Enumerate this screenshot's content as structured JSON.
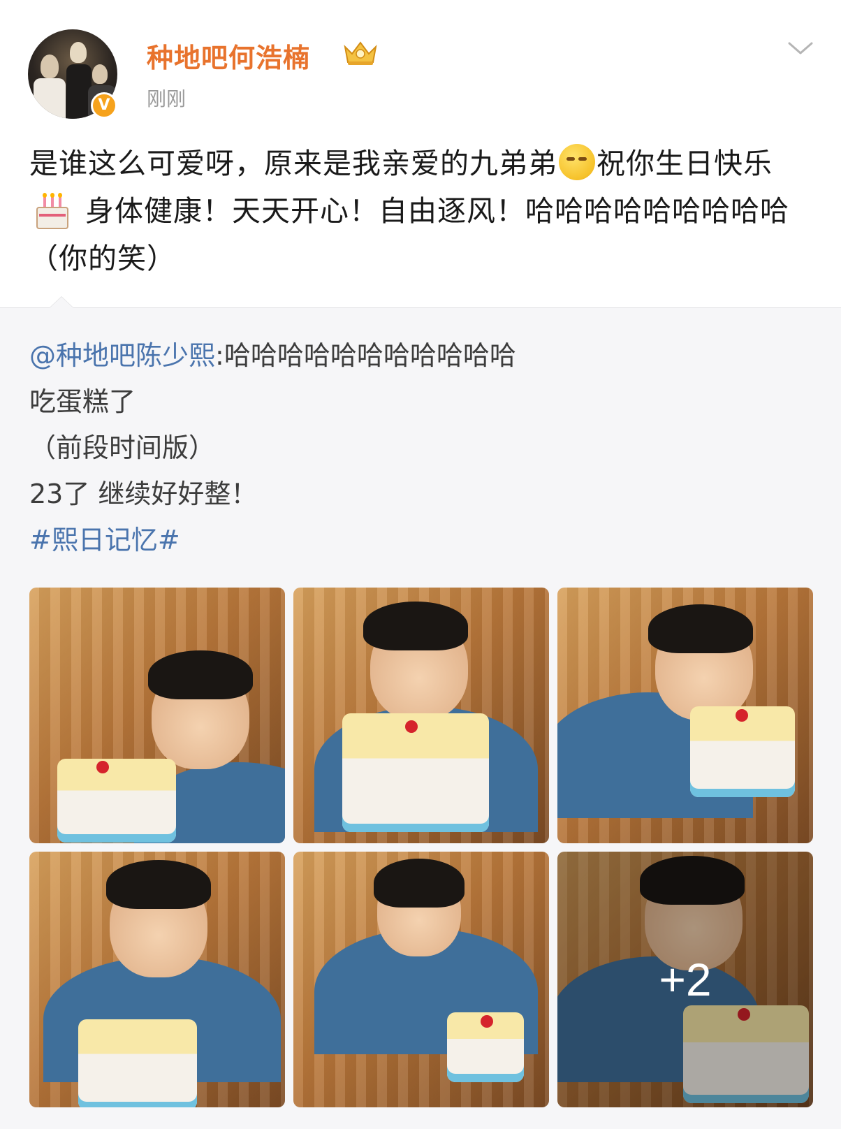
{
  "post": {
    "username": "种地吧何浩楠",
    "time": "刚刚",
    "text_part1": "是谁这么可爱呀，原来是我亲爱的九弟弟",
    "emoji1": "smirk-emoji",
    "text_part2": "祝你生日快乐",
    "emoji2": "birthday-cake-emoji",
    "text_part3": "身体健康！天天开心！自由逐风！哈哈哈哈哈哈哈哈哈（你的笑）"
  },
  "repost": {
    "mention": "@种地吧陈少熙",
    "mention_suffix": ":哈哈哈哈哈哈哈哈哈哈哈",
    "line2": "吃蛋糕了",
    "line3": "（前段时间版）",
    "line4": "23了 继续好好整！",
    "hashtag": "#熙日记忆#"
  },
  "photos": {
    "more_count": "+2"
  },
  "icons": {
    "crown": "crown-badge-icon",
    "verified": "verified-v-icon",
    "dropdown": "chevron-down-icon"
  },
  "colors": {
    "username": "#e8732d",
    "link": "#4a74ad",
    "repost_bg": "#f6f6f8"
  }
}
